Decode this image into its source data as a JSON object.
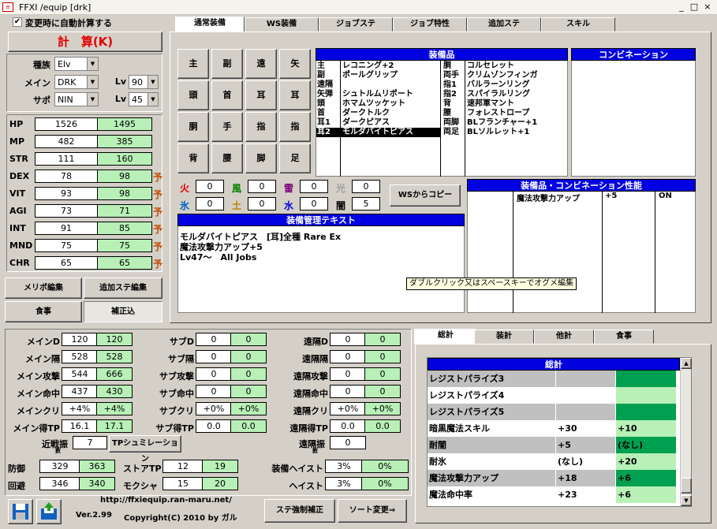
{
  "window": {
    "title": "FFXI /equip [drk]",
    "min": "_",
    "max": "□",
    "close": "×"
  },
  "autocalc": "変更時に自動計算する",
  "calc_button": "計　算(K)",
  "race": {
    "label": "種族",
    "value": "Elv"
  },
  "main_job": {
    "label": "メイン",
    "value": "DRK",
    "lv_label": "Lv",
    "lv": "90"
  },
  "sub_job": {
    "label": "サポ",
    "value": "NIN",
    "lv_label": "Lv",
    "lv": "45"
  },
  "stats": [
    {
      "name": "HP",
      "base": "1526",
      "total": "1495",
      "pred": ""
    },
    {
      "name": "MP",
      "base": "482",
      "total": "385",
      "pred": ""
    },
    {
      "name": "STR",
      "base": "111",
      "total": "160",
      "pred": ""
    },
    {
      "name": "DEX",
      "base": "78",
      "total": "98",
      "pred": "予"
    },
    {
      "name": "VIT",
      "base": "93",
      "total": "98",
      "pred": "予"
    },
    {
      "name": "AGI",
      "base": "73",
      "total": "71",
      "pred": "予"
    },
    {
      "name": "INT",
      "base": "91",
      "total": "85",
      "pred": "予"
    },
    {
      "name": "MND",
      "base": "75",
      "total": "75",
      "pred": "予"
    },
    {
      "name": "CHR",
      "base": "65",
      "total": "65",
      "pred": "予"
    }
  ],
  "btn": {
    "merit": "メリポ編集",
    "extra": "追加ステ編集",
    "food": "食事",
    "correct": "補正込",
    "ws_copy": "WSからコピー",
    "tp_sim": "TPシュミレーション",
    "stat_force": "ステ強制補正",
    "sort": "ソート変更⇒"
  },
  "tabs": [
    "通常装備",
    "WS装備",
    "ジョブステ",
    "ジョブ特性",
    "追加ステ",
    "スキル"
  ],
  "slots": [
    "主",
    "副",
    "遠",
    "矢",
    "頭",
    "首",
    "耳",
    "耳",
    "胴",
    "手",
    "指",
    "指",
    "背",
    "腰",
    "脚",
    "足"
  ],
  "equip_header": "装備品",
  "combo_header": "コンビネーション",
  "equip_left": [
    {
      "slot": "主",
      "name": "レコニング+2",
      "selected": false
    },
    {
      "slot": "副",
      "name": "ポールグリップ",
      "selected": false
    },
    {
      "slot": "遠隔",
      "name": "",
      "selected": false
    },
    {
      "slot": "矢弾",
      "name": "シュトルムリポート",
      "selected": false
    },
    {
      "slot": "頭",
      "name": "ホマムツッケット",
      "selected": false
    },
    {
      "slot": "首",
      "name": "ダークトルク",
      "selected": false
    },
    {
      "slot": "耳1",
      "name": "ダークピアス",
      "selected": false
    },
    {
      "slot": "耳2",
      "name": "モルダバイトピアス",
      "selected": true
    }
  ],
  "equip_right": [
    {
      "slot": "胴",
      "name": "コルセレット"
    },
    {
      "slot": "両手",
      "name": "クリムゾンフィンガ"
    },
    {
      "slot": "指1",
      "name": "バルラーンリング"
    },
    {
      "slot": "指2",
      "name": "スパイラルリング"
    },
    {
      "slot": "背",
      "name": "速邦軍マント"
    },
    {
      "slot": "腰",
      "name": "フォレストロープ"
    },
    {
      "slot": "両脚",
      "name": "BLフランチャー+1"
    },
    {
      "slot": "両足",
      "name": "BLソルレット+1"
    }
  ],
  "elements": [
    {
      "label": "火",
      "value": "0",
      "color": "#e00000"
    },
    {
      "label": "風",
      "value": "0",
      "color": "#008000"
    },
    {
      "label": "雷",
      "value": "0",
      "color": "#800080"
    },
    {
      "label": "光",
      "value": "0",
      "color": "#a0a0a0"
    },
    {
      "label": "氷",
      "value": "0",
      "color": "#0060c0"
    },
    {
      "label": "土",
      "value": "0",
      "color": "#c08000"
    },
    {
      "label": "水",
      "value": "0",
      "color": "#0000e0"
    },
    {
      "label": "闇",
      "value": "5",
      "color": "#000000"
    }
  ],
  "perf_header": "装備品・コンビネーション性能",
  "perf": [
    {
      "name": "魔法攻撃力アップ",
      "value": "+5",
      "state": "ON"
    }
  ],
  "desc_header": "装備管理テキスト",
  "desc_lines": [
    "モルダバイトピアス　[耳]全種 Rare Ex",
    "魔法攻撃力アップ+5",
    "Lv47～　All Jobs"
  ],
  "tooltip": "ダブルクリック又はスペースキーでオグメ編集",
  "battle": {
    "mainD": {
      "label": "メインD",
      "a": "120",
      "b": "120"
    },
    "mainK": {
      "label": "メイン隔",
      "a": "528",
      "b": "528"
    },
    "mainAtk": {
      "label": "メイン攻撃",
      "a": "544",
      "b": "666"
    },
    "mainAcc": {
      "label": "メイン命中",
      "a": "437",
      "b": "430"
    },
    "mainCrit": {
      "label": "メインクリ",
      "a": "+4%",
      "b": "+4%"
    },
    "mainTP": {
      "label": "メイン得TP",
      "a": "16.1",
      "b": "17.1"
    },
    "subD": {
      "label": "サブD",
      "a": "0",
      "b": "0"
    },
    "subK": {
      "label": "サブ隔",
      "a": "0",
      "b": "0"
    },
    "subAtk": {
      "label": "サブ攻撃",
      "a": "0",
      "b": "0"
    },
    "subAcc": {
      "label": "サブ命中",
      "a": "0",
      "b": "0"
    },
    "subCrit": {
      "label": "サブクリ",
      "a": "+0%",
      "b": "+0%"
    },
    "subTP": {
      "label": "サブ得TP",
      "a": "0.0",
      "b": "0.0"
    },
    "rngD": {
      "label": "遠隔D",
      "a": "0",
      "b": "0"
    },
    "rngK": {
      "label": "遠隔隔",
      "a": "0",
      "b": "0"
    },
    "rngAtk": {
      "label": "遠隔攻撃",
      "a": "0",
      "b": "0"
    },
    "rngAcc": {
      "label": "遠隔命中",
      "a": "0",
      "b": "0"
    },
    "rngCrit": {
      "label": "遠隔クリ",
      "a": "+0%",
      "b": "+0%"
    },
    "rngTP": {
      "label": "遠隔得TP",
      "a": "0.0",
      "b": "0.0"
    },
    "melee": {
      "label": "近戦振",
      "sub": "數",
      "a": "7"
    },
    "ranged": {
      "label": "遠隔振",
      "sub": "數",
      "a": "0"
    },
    "def": {
      "label": "防御",
      "a": "329",
      "b": "363"
    },
    "eva": {
      "label": "回避",
      "a": "346",
      "b": "340"
    },
    "storeTP": {
      "label": "ストアTP",
      "a": "12",
      "b": "19"
    },
    "mokusha": {
      "label": "モクシャ",
      "a": "15",
      "b": "20"
    },
    "gearHaste": {
      "label": "装備ヘイスト",
      "a": "3%",
      "b": "0%"
    },
    "haste": {
      "label": "ヘイスト",
      "a": "3%",
      "b": "0%"
    }
  },
  "url": "http://ffxiequip.ran-maru.net/",
  "version": "Ver.2.99",
  "copyright": "Copyright(C) 2010 by ガル",
  "sum_tabs": [
    "総計",
    "装計",
    "他計",
    "食事"
  ],
  "sum_header": "総計",
  "sum_rows": [
    {
      "name": "レジストパライズ3",
      "a": "",
      "b": "",
      "shade": "gray"
    },
    {
      "name": "レジストパライズ4",
      "a": "",
      "b": "",
      "shade": "white"
    },
    {
      "name": "レジストパライズ5",
      "a": "",
      "b": "",
      "shade": "gray"
    },
    {
      "name": "暗黒魔法スキル",
      "a": "+30",
      "b": "+10",
      "shade": "white"
    },
    {
      "name": "耐闇",
      "a": "+5",
      "b": "(なし)",
      "shade": "gray"
    },
    {
      "name": "耐氷",
      "a": "(なし)",
      "b": "+20",
      "shade": "white"
    },
    {
      "name": "魔法攻撃力アップ",
      "a": "+18",
      "b": "+6",
      "shade": "gray"
    },
    {
      "name": "魔法命中率",
      "a": "+23",
      "b": "+6",
      "shade": "white"
    }
  ]
}
